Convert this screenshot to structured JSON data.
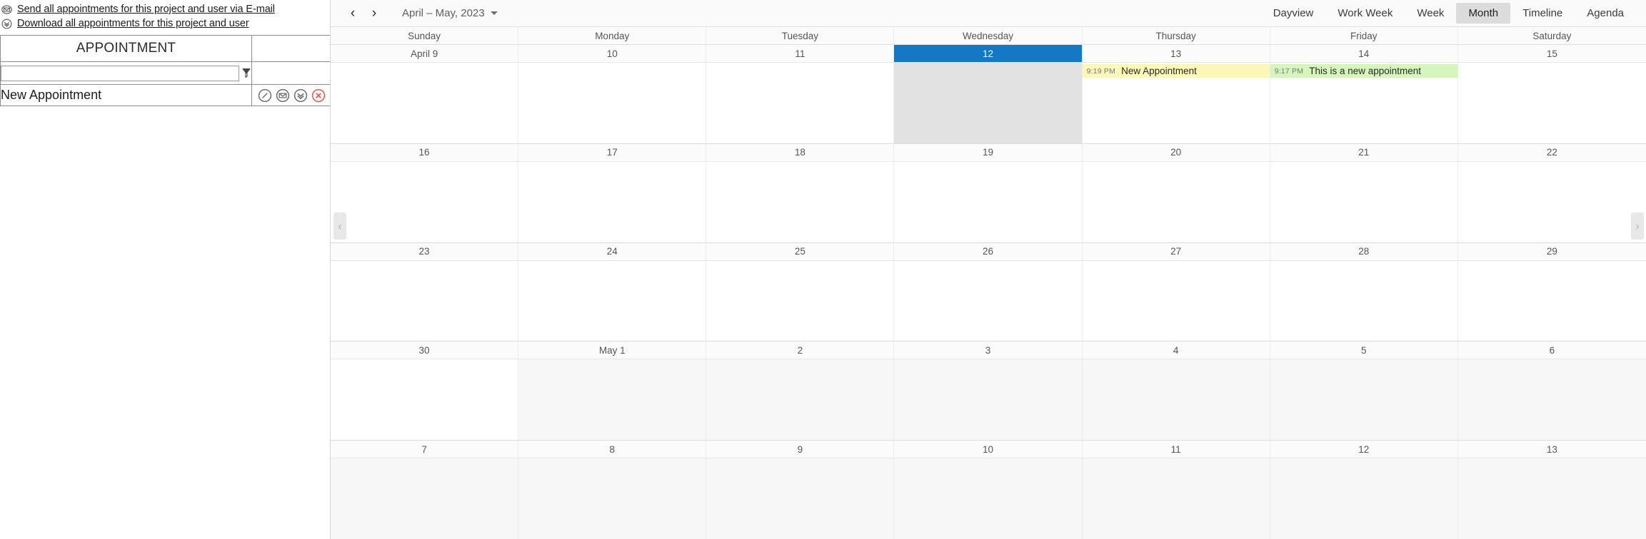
{
  "left_panel": {
    "links": [
      {
        "icon": "envelope-icon",
        "label": "Send all appointments for this project and user via E-mail"
      },
      {
        "icon": "download-chevron-icon",
        "label": "Download all appointments for this project and user"
      }
    ],
    "table": {
      "header": "APPOINTMENT",
      "filter": {
        "value": "",
        "placeholder": ""
      },
      "filter_icon": "funnel-filter-icon",
      "rows": [
        {
          "title": "New Appointment",
          "actions": [
            {
              "icon": "edit-circle-icon",
              "label": "Edit"
            },
            {
              "icon": "envelope-circle-icon",
              "label": "E-mail"
            },
            {
              "icon": "download-circle-icon",
              "label": "Download"
            },
            {
              "icon": "delete-circle-icon",
              "label": "Delete"
            }
          ]
        }
      ]
    }
  },
  "scheduler": {
    "toolbar": {
      "prev_label": "‹",
      "next_label": "›",
      "date_range": "April – May, 2023",
      "views": [
        {
          "label": "Dayview",
          "active": false
        },
        {
          "label": "Work Week",
          "active": false
        },
        {
          "label": "Week",
          "active": false
        },
        {
          "label": "Month",
          "active": true
        },
        {
          "label": "Timeline",
          "active": false
        },
        {
          "label": "Agenda",
          "active": false
        }
      ]
    },
    "day_names": [
      "Sunday",
      "Monday",
      "Tuesday",
      "Wednesday",
      "Thursday",
      "Friday",
      "Saturday"
    ],
    "side_nav": {
      "prev": "‹",
      "next": "›"
    },
    "weeks": [
      {
        "days": [
          {
            "num": "April 9",
            "other_month": false,
            "selected": false,
            "events": []
          },
          {
            "num": "10",
            "other_month": false,
            "selected": false,
            "events": []
          },
          {
            "num": "11",
            "other_month": false,
            "selected": false,
            "events": []
          },
          {
            "num": "12",
            "other_month": false,
            "selected": true,
            "events": []
          },
          {
            "num": "13",
            "other_month": false,
            "selected": false,
            "events": [
              {
                "time": "9:19 PM",
                "title": "New Appointment",
                "color": "#fbf7b6"
              }
            ]
          },
          {
            "num": "14",
            "other_month": false,
            "selected": false,
            "events": [
              {
                "time": "9:17 PM",
                "title": "This is a new appointment",
                "color": "#d6f5ba"
              }
            ]
          },
          {
            "num": "15",
            "other_month": false,
            "selected": false,
            "events": []
          }
        ]
      },
      {
        "days": [
          {
            "num": "16",
            "other_month": false,
            "selected": false,
            "events": []
          },
          {
            "num": "17",
            "other_month": false,
            "selected": false,
            "events": []
          },
          {
            "num": "18",
            "other_month": false,
            "selected": false,
            "events": []
          },
          {
            "num": "19",
            "other_month": false,
            "selected": false,
            "events": []
          },
          {
            "num": "20",
            "other_month": false,
            "selected": false,
            "events": []
          },
          {
            "num": "21",
            "other_month": false,
            "selected": false,
            "events": []
          },
          {
            "num": "22",
            "other_month": false,
            "selected": false,
            "events": []
          }
        ]
      },
      {
        "days": [
          {
            "num": "23",
            "other_month": false,
            "selected": false,
            "events": []
          },
          {
            "num": "24",
            "other_month": false,
            "selected": false,
            "events": []
          },
          {
            "num": "25",
            "other_month": false,
            "selected": false,
            "events": []
          },
          {
            "num": "26",
            "other_month": false,
            "selected": false,
            "events": []
          },
          {
            "num": "27",
            "other_month": false,
            "selected": false,
            "events": []
          },
          {
            "num": "28",
            "other_month": false,
            "selected": false,
            "events": []
          },
          {
            "num": "29",
            "other_month": false,
            "selected": false,
            "events": []
          }
        ]
      },
      {
        "days": [
          {
            "num": "30",
            "other_month": false,
            "selected": false,
            "events": []
          },
          {
            "num": "May 1",
            "other_month": true,
            "selected": false,
            "events": []
          },
          {
            "num": "2",
            "other_month": true,
            "selected": false,
            "events": []
          },
          {
            "num": "3",
            "other_month": true,
            "selected": false,
            "events": []
          },
          {
            "num": "4",
            "other_month": true,
            "selected": false,
            "events": []
          },
          {
            "num": "5",
            "other_month": true,
            "selected": false,
            "events": []
          },
          {
            "num": "6",
            "other_month": true,
            "selected": false,
            "events": []
          }
        ]
      },
      {
        "days": [
          {
            "num": "7",
            "other_month": true,
            "selected": false,
            "events": []
          },
          {
            "num": "8",
            "other_month": true,
            "selected": false,
            "events": []
          },
          {
            "num": "9",
            "other_month": true,
            "selected": false,
            "events": []
          },
          {
            "num": "10",
            "other_month": true,
            "selected": false,
            "events": []
          },
          {
            "num": "11",
            "other_month": true,
            "selected": false,
            "events": []
          },
          {
            "num": "12",
            "other_month": true,
            "selected": false,
            "events": []
          },
          {
            "num": "13",
            "other_month": true,
            "selected": false,
            "events": []
          }
        ]
      }
    ]
  },
  "colors": {
    "selected_day": "#1578c4",
    "selected_column": "#e2e2e2",
    "event_yellow": "#fbf7b6",
    "event_green": "#d6f5ba",
    "active_view": "#dcdcdc"
  }
}
